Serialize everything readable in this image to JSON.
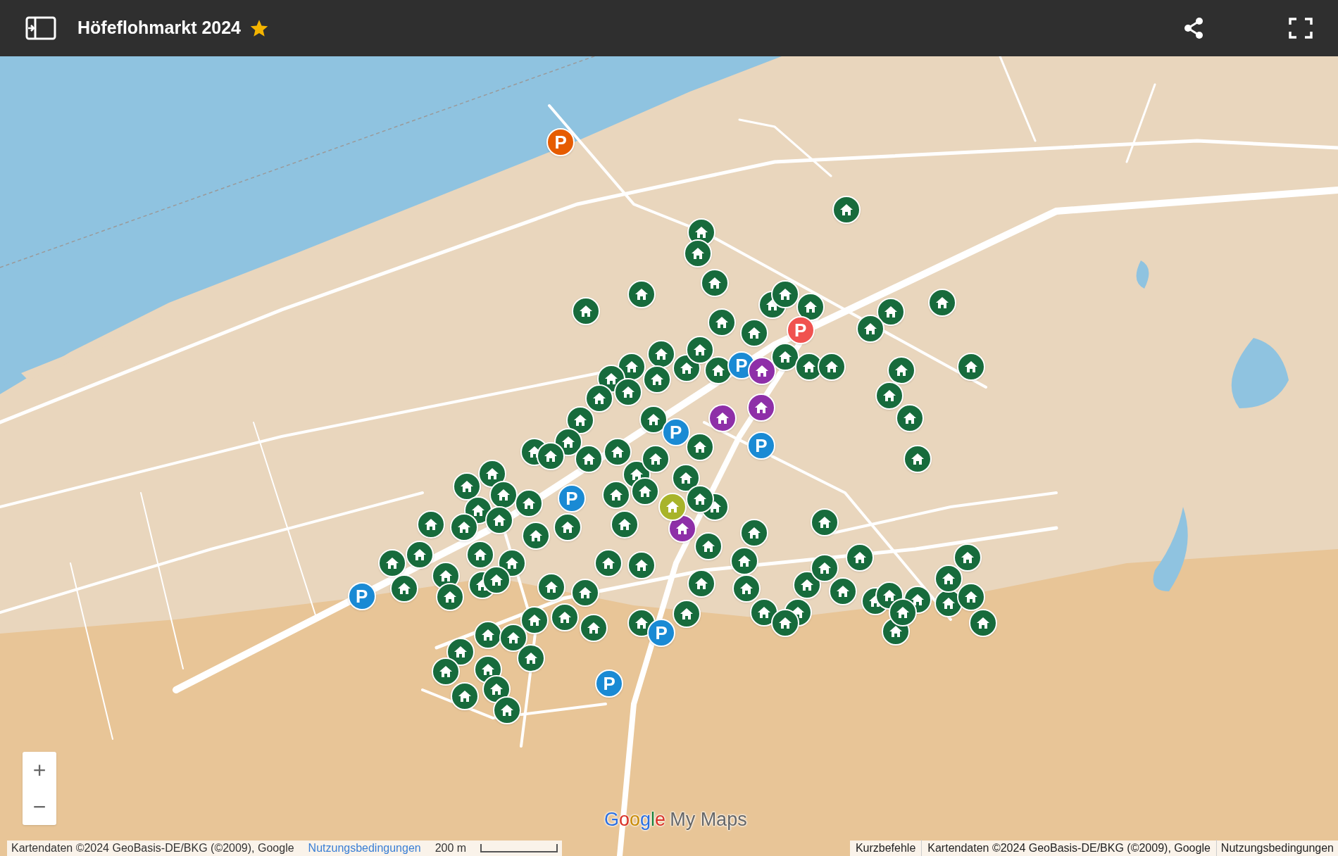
{
  "header": {
    "title": "Höfeflohmarkt 2024",
    "starred": true
  },
  "map": {
    "zoom_in": "+",
    "zoom_out": "−",
    "logo": {
      "brand": "Google",
      "product": "My Maps"
    },
    "markers": [
      {
        "kind": "parking",
        "color": "#e65c00",
        "label": "P"
      },
      {
        "kind": "parking",
        "color": "#f0524f",
        "label": "P"
      },
      {
        "kind": "parking",
        "color": "#1a8ad4",
        "label": "P"
      },
      {
        "kind": "parking",
        "color": "#1a8ad4",
        "label": "P"
      },
      {
        "kind": "parking",
        "color": "#1a8ad4",
        "label": "P"
      },
      {
        "kind": "parking",
        "color": "#1a8ad4",
        "label": "P"
      },
      {
        "kind": "parking",
        "color": "#1a8ad4",
        "label": "P"
      },
      {
        "kind": "parking",
        "color": "#1a8ad4",
        "label": "P"
      },
      {
        "kind": "parking",
        "color": "#1a8ad4",
        "label": "P"
      },
      {
        "kind": "house",
        "color": "#8e2fa8"
      },
      {
        "kind": "house",
        "color": "#8e2fa8"
      },
      {
        "kind": "house",
        "color": "#8e2fa8"
      },
      {
        "kind": "house",
        "color": "#8e2fa8"
      },
      {
        "kind": "house",
        "color": "#a8b42a"
      }
    ],
    "attribution_left": "Kartendaten ©2024 GeoBasis-DE/BKG (©2009), Google",
    "terms_left": "Nutzungsbedingungen",
    "scale": "200 m",
    "shortcuts": "Kurzbefehle",
    "attribution_right": "Kartendaten ©2024 GeoBasis-DE/BKG (©2009), Google",
    "terms_right": "Nutzungsbedingungen"
  }
}
